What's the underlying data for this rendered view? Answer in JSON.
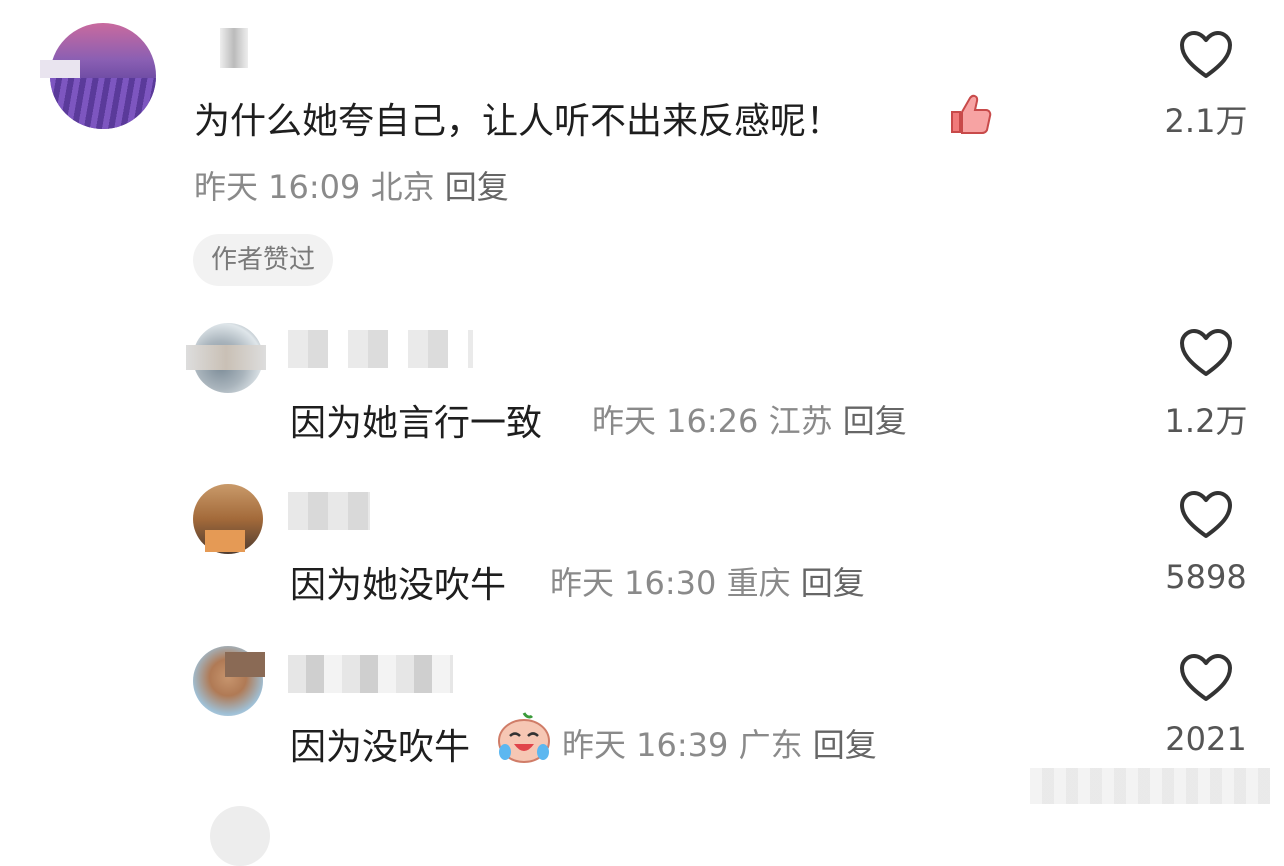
{
  "comments": [
    {
      "text": "为什么她夸自己，让人听不出来反感呢！",
      "time": "昨天 16:09",
      "location": "北京",
      "reply_label": "回复",
      "likes": "2.1万",
      "badge": "作者赞过",
      "emoji": "thumbs-up-icon"
    },
    {
      "text": "因为她言行一致",
      "time": "昨天 16:26",
      "location": "江苏",
      "reply_label": "回复",
      "likes": "1.2万"
    },
    {
      "text": "因为她没吹牛",
      "time": "昨天 16:30",
      "location": "重庆",
      "reply_label": "回复",
      "likes": "5898"
    },
    {
      "text": "因为没吹牛",
      "time": "昨天 16:39",
      "location": "广东",
      "reply_label": "回复",
      "likes": "2021",
      "emoji": "crying-laughing-face-icon"
    }
  ],
  "colors": {
    "text": "#1e1e1e",
    "meta": "#8a8a8a",
    "badge_bg": "#f2f2f2",
    "heart_stroke": "#333333"
  }
}
